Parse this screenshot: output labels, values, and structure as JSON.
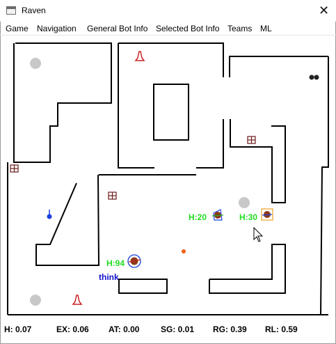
{
  "window": {
    "title": "Raven",
    "close_glyph": "✕"
  },
  "menu": [
    "Game",
    "Navigation",
    "General Bot Info",
    "Selected Bot Info",
    "Teams",
    "ML"
  ],
  "map": {
    "bots": [
      {
        "health_label": "H:94",
        "state_label": "think",
        "selected": false,
        "color": "#8b3a1a"
      },
      {
        "health_label": "H:20",
        "selected": false,
        "color": "#8b3a1a"
      },
      {
        "health_label": "H:30",
        "selected": true,
        "color": "#8b3a1a"
      }
    ],
    "colors": {
      "wall": "#000000",
      "health_text": "#22dd22",
      "state_text": "#1111cc",
      "spawn_point": "#c8c8c8",
      "item_red": "#cc2222",
      "crate": "#6b1a1a",
      "selection_box": "#e8a020",
      "player_marker": "#1a40e0"
    }
  },
  "status": {
    "h": "H: 0.07",
    "ex": "EX: 0.06",
    "at": "AT: 0.00",
    "sg": "SG: 0.01",
    "rg": "RG: 0.39",
    "rl": "RL: 0.59"
  }
}
